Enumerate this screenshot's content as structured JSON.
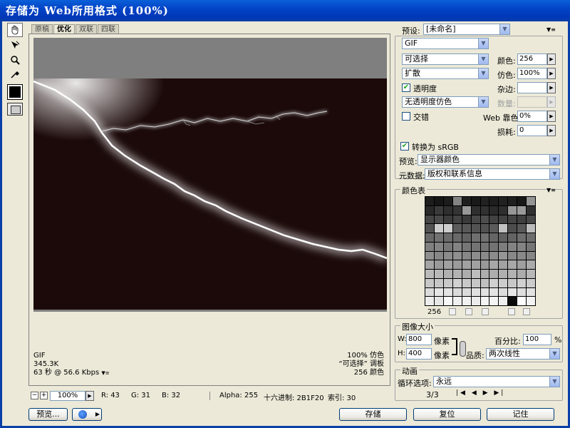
{
  "window": {
    "title": "存储为 Web所用格式 (100%)"
  },
  "tabs": [
    "原稿",
    "优化",
    "双联",
    "四联"
  ],
  "tools": [
    "hand-icon",
    "slice-select-icon",
    "zoom-icon",
    "eyedropper-icon"
  ],
  "canvas_info": {
    "left": [
      "GIF",
      "345.3K",
      "63 秒 @ 56.6 Kbps"
    ],
    "right": [
      "100% 仿色",
      "“可选择” 调板",
      "256 颜色"
    ]
  },
  "statusbar": {
    "zoom": "100%",
    "r": "R: 43",
    "g": "G: 31",
    "b": "B: 32",
    "alpha": "Alpha: 255",
    "hex": "十六进制: 2B1F20",
    "index": "索引: 30"
  },
  "buttons": {
    "preview": "预览...",
    "save": "存储",
    "reset": "复位",
    "remember": "记住"
  },
  "settings": {
    "preset_label": "预设:",
    "preset_value": "[未命名]",
    "format": "GIF",
    "reduction": "可选择",
    "dither_algo": "扩散",
    "transparency_label": "透明度",
    "transparency_checked": true,
    "trans_dither": "无透明度仿色",
    "interlace_label": "交错",
    "interlace_checked": false,
    "colors_label": "颜色:",
    "colors_value": "256",
    "dither_label": "仿色:",
    "dither_value": "100%",
    "matte_label": "杂边:",
    "amount_label": "数量:",
    "web_snap_label": "Web 靠色:",
    "web_snap_value": "0%",
    "lossy_label": "损耗:",
    "lossy_value": "0",
    "srgb_label": "转换为 sRGB",
    "srgb_checked": true,
    "preview_label": "预览:",
    "preview_value": "显示器颜色",
    "metadata_label": "元数据:",
    "metadata_value": "版权和联系信息"
  },
  "color_table": {
    "title": "颜色表",
    "count": "256"
  },
  "image_size": {
    "title": "图像大小",
    "w_label": "W:",
    "w_value": "800",
    "h_label": "H:",
    "h_value": "400",
    "unit": "像素",
    "percent_label": "百分比:",
    "percent_value": "100",
    "percent_unit": "%",
    "quality_label": "品质:",
    "quality_value": "两次线性"
  },
  "animation": {
    "title": "动画",
    "loop_label": "循环选项:",
    "loop_value": "永远",
    "frame": "3/3"
  },
  "colors": {
    "titlebar": "#0344c7",
    "image_bg": "#1c0a0a",
    "canvas_gray": "#7f7f7f"
  }
}
